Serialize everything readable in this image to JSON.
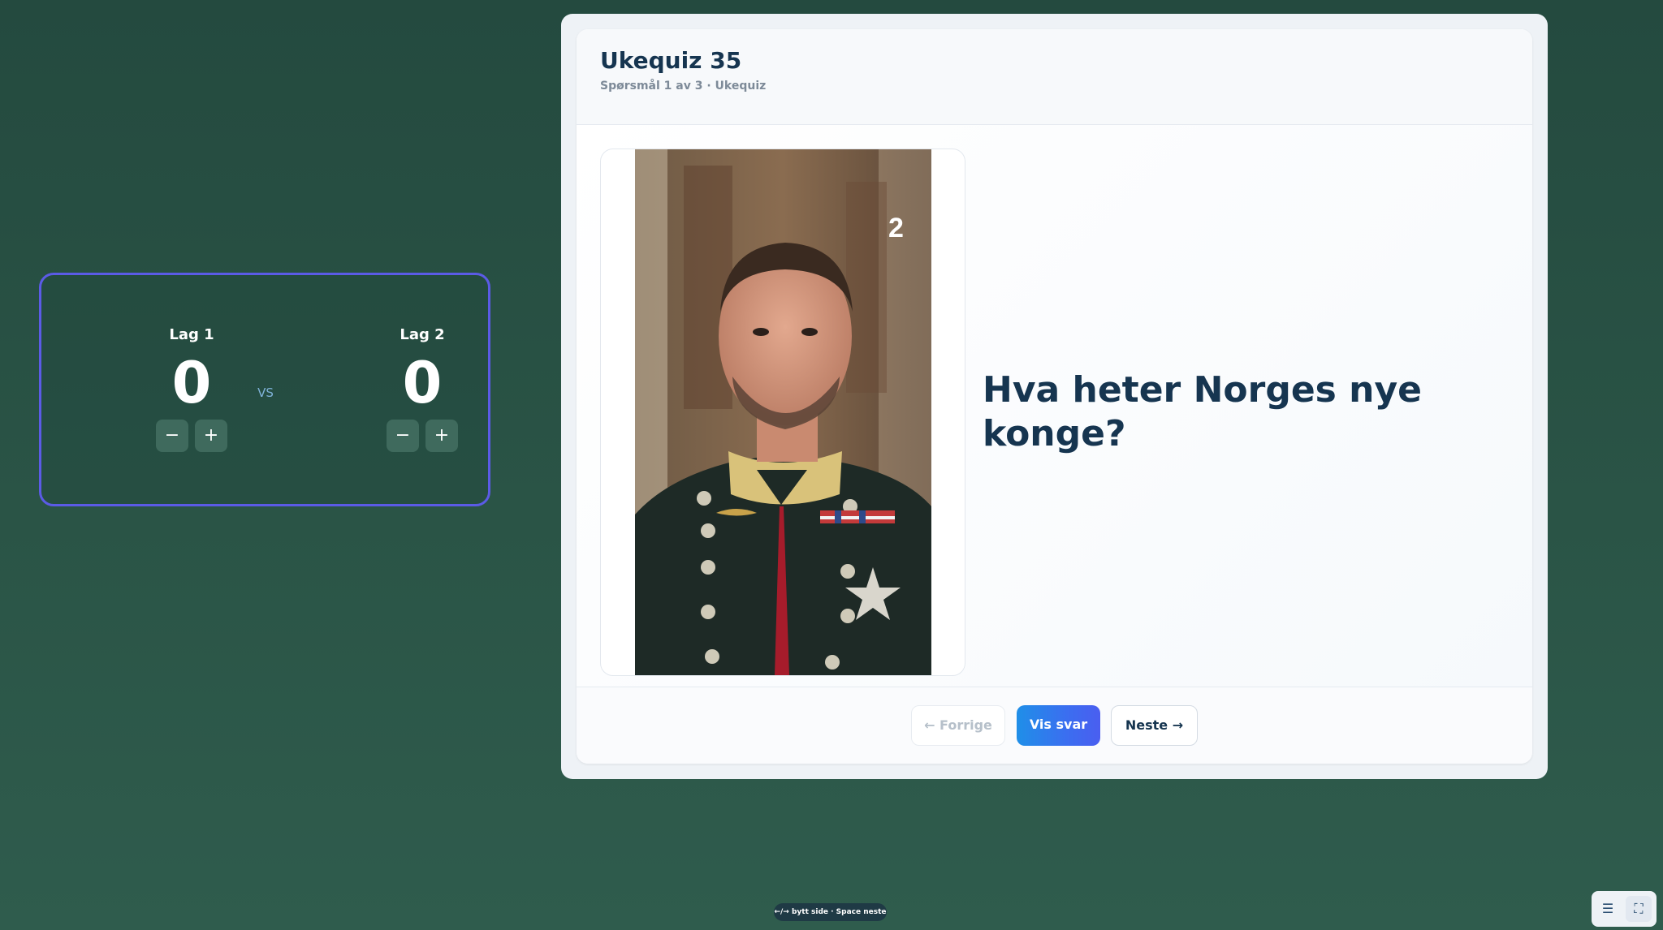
{
  "scoreboard": {
    "teams": [
      {
        "name": "Lag 1",
        "score": "0",
        "minus": "−",
        "plus": "+"
      },
      {
        "name": "Lag 2",
        "score": "0",
        "minus": "−",
        "plus": "+"
      }
    ],
    "vs_label": "VS",
    "border_color": "#5b5be6"
  },
  "quiz": {
    "title": "Ukequiz 35",
    "subtitle": "Spørsmål 1 av 3 · Ukequiz",
    "question": "Hva heter Norges nye konge?",
    "image_badge": "2",
    "image_description_icon": "portrait-photo"
  },
  "navigation": {
    "prev_label": "← Forrige",
    "reveal_label": "Vis svar",
    "next_label": "Neste →"
  },
  "hint": "←/→ bytt side · Space neste",
  "toolbar": {
    "menu_icon": "☰",
    "fullscreen_icon": "⛶"
  },
  "colors": {
    "background": "#2a5446",
    "title": "#163550",
    "reveal_button": "#1f8fe8"
  }
}
